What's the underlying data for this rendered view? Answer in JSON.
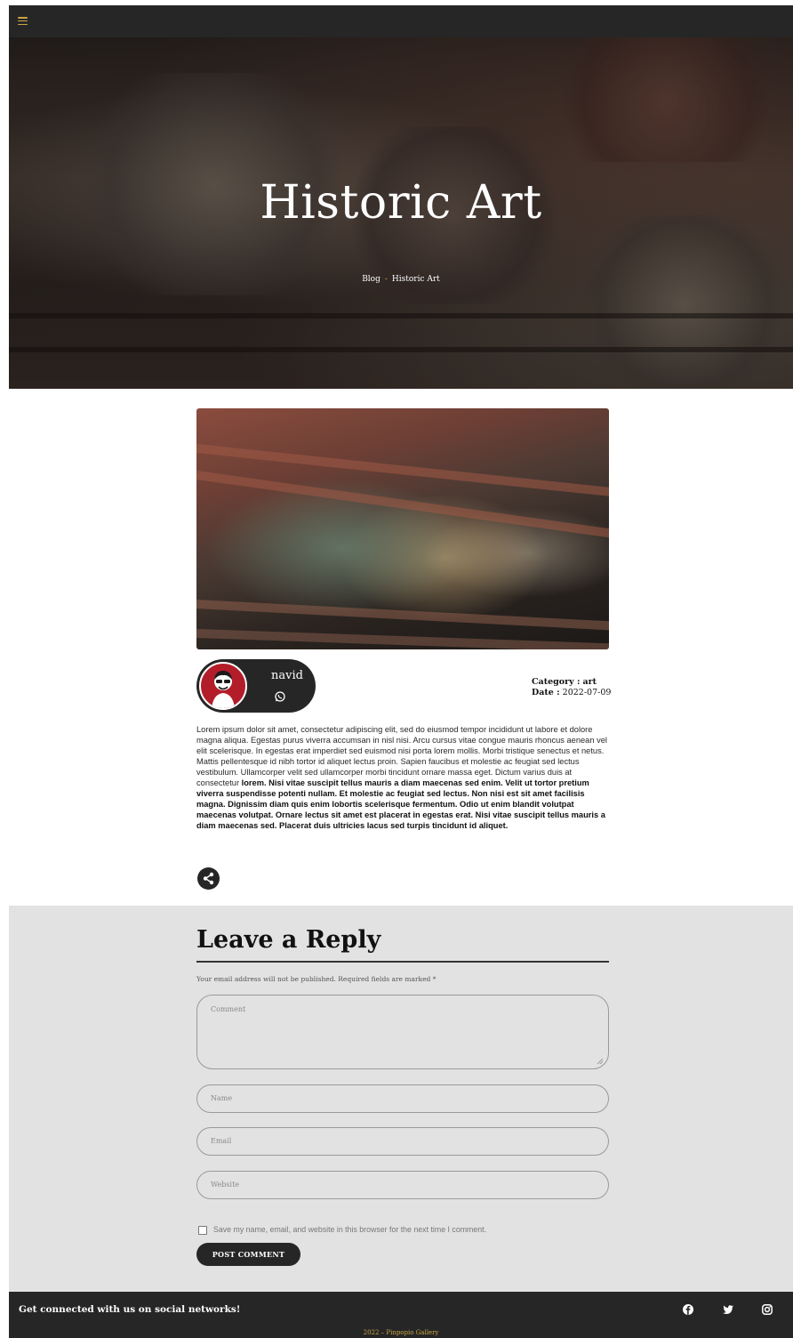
{
  "header": {
    "menu_icon": "hamburger-menu-icon",
    "accent_color": "#c9a544",
    "bar_color": "#262626"
  },
  "hero": {
    "title": "Historic Art",
    "breadcrumb": {
      "home": "Blog",
      "separator": "-",
      "current": "Historic Art"
    }
  },
  "post": {
    "author": {
      "name": "navid",
      "contact_icon": "whatsapp-icon"
    },
    "meta": {
      "category_label": "Category :",
      "category_value": "art",
      "date_label": "Date :",
      "date_value": "2022-07-09"
    },
    "body_regular": "Lorem ipsum dolor sit amet, consectetur adipiscing elit, sed do eiusmod tempor incididunt ut labore et dolore magna aliqua. Egestas purus viverra accumsan in nisl nisi. Arcu cursus vitae congue mauris rhoncus aenean vel elit scelerisque. In egestas erat imperdiet sed euismod nisi porta lorem mollis. Morbi tristique senectus et netus. Mattis pellentesque id nibh tortor id aliquet lectus proin. Sapien faucibus et molestie ac feugiat sed lectus vestibulum. Ullamcorper velit sed ullamcorper morbi tincidunt ornare massa eget. Dictum varius duis at consectetur ",
    "body_bold": "lorem. Nisi vitae suscipit tellus mauris a diam maecenas sed enim. Velit ut tortor pretium viverra suspendisse potenti nullam. Et molestie ac feugiat sed lectus. Non nisi est sit amet facilisis magna. Dignissim diam quis enim lobortis scelerisque fermentum. Odio ut enim blandit volutpat maecenas volutpat. Ornare lectus sit amet est placerat in egestas erat. Nisi vitae suscipit tellus mauris a diam maecenas sed. Placerat duis ultricies lacus sed turpis tincidunt id aliquet.",
    "share_icon": "share-icon"
  },
  "reply": {
    "title": "Leave a Reply",
    "note": "Your email address will not be published. Required fields are marked *",
    "comment_placeholder": "Comment",
    "name_placeholder": "Name",
    "email_placeholder": "Email",
    "website_placeholder": "Website",
    "save_label": "Save my name, email, and website in this browser for the next time I comment.",
    "submit_label": "POST COMMENT"
  },
  "footer": {
    "social_text": "Get connected with us on social networks!",
    "social_icons": [
      "facebook-icon",
      "twitter-icon",
      "instagram-icon"
    ],
    "copyright": "2022 – Pinpopio Gallery"
  }
}
